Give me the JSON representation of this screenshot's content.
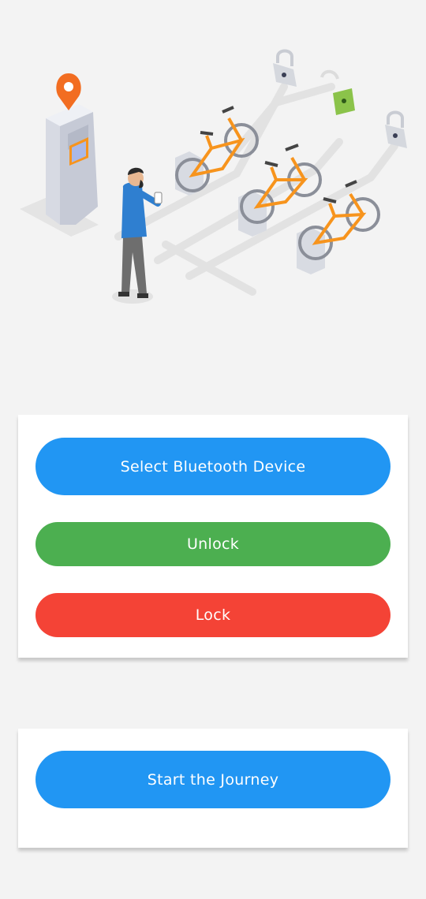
{
  "colors": {
    "background": "#f3f3f3",
    "blue": "#2196f3",
    "green": "#4caf50",
    "red": "#f44336",
    "bike_orange": "#f7941d",
    "pin_orange": "#f26d21",
    "lock_green": "#8bc34a"
  },
  "illustration": {
    "icons": [
      "location-pin-icon",
      "padlock-locked-icon",
      "padlock-unlocked-icon",
      "bicycle-icon",
      "smartphone-icon"
    ]
  },
  "controls": {
    "select_device_label": "Select Bluetooth Device",
    "unlock_label": "Unlock",
    "lock_label": "Lock"
  },
  "journey": {
    "start_label": "Start the Journey"
  }
}
